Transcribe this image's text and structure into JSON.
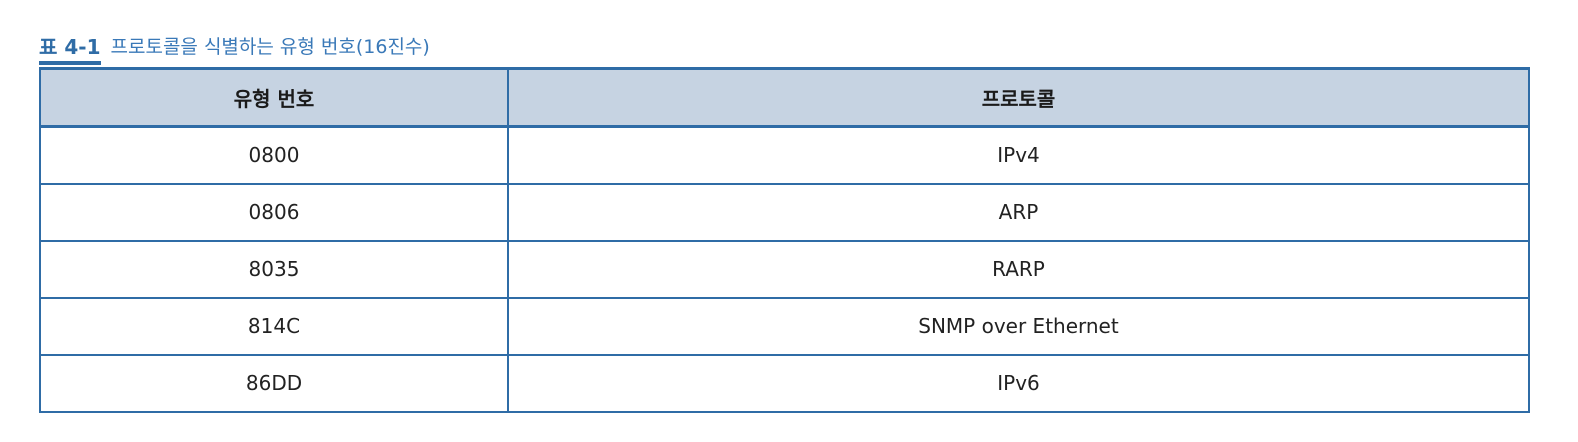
{
  "caption": {
    "number": "표 4-1",
    "title": "프로토콜을 식별하는 유형 번호(16진수)"
  },
  "table": {
    "headers": [
      "유형 번호",
      "프로토콜"
    ],
    "rows": [
      [
        "0800",
        "IPv4"
      ],
      [
        "0806",
        "ARP"
      ],
      [
        "8035",
        "RARP"
      ],
      [
        "814C",
        "SNMP over Ethernet"
      ],
      [
        "86DD",
        "IPv6"
      ]
    ]
  },
  "colors": {
    "accent": "#2f6ca6",
    "header_bg": "#c6d3e2"
  }
}
